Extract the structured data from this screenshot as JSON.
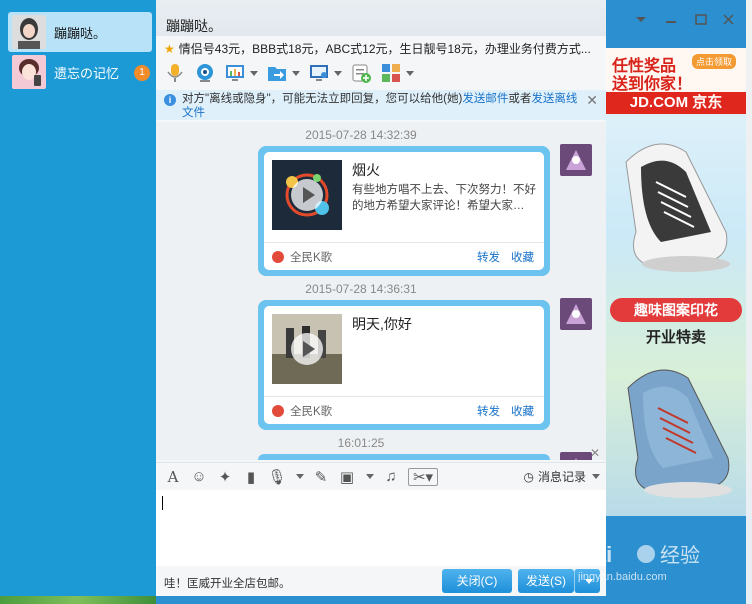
{
  "contacts": [
    {
      "name": "蹦蹦哒。",
      "active": true
    },
    {
      "name": "遗忘の记忆",
      "active": false,
      "badge": "1"
    }
  ],
  "window": {
    "title": "蹦蹦哒。",
    "signature": "情侣号43元，BBB式18元，ABC式12元，生日靓号18元，办理业务付费方式..."
  },
  "toolbar": {
    "icons": [
      "microphone-icon",
      "video-camera-icon",
      "screen-share-icon",
      "file-transfer-icon",
      "remote-desktop-icon",
      "add-app-icon",
      "apps-grid-icon"
    ]
  },
  "notice": {
    "text": "对方\"离线或隐身\"，可能无法立即回复，您可以给他(她)",
    "link1": "发送邮件",
    "middle": "或者",
    "link2": "发送离线文件"
  },
  "messages": [
    {
      "timestamp": "2015-07-28 14:32:39",
      "card_title": "烟火",
      "card_desc": "有些地方唱不上去、下次努力！不好的地方希望大家评论！希望大家…",
      "app": "全民K歌",
      "share": "转发",
      "favorite": "收藏"
    },
    {
      "timestamp": "2015-07-28 14:36:31",
      "card_title": "明天,你好",
      "card_desc": "",
      "app": "全民K歌",
      "share": "转发",
      "favorite": "收藏"
    },
    {
      "timestamp": "16:01:25"
    }
  ],
  "input_toolbar": {
    "message_record": "消息记录"
  },
  "bottom": {
    "tip": "哇！匡威开业全店包邮。",
    "close": "关闭(C)",
    "send": "发送(S)"
  },
  "ad": {
    "line1": "任性奖品",
    "chip": "点击领取",
    "line2": "送到你家！",
    "brand": "JD.COM 京东",
    "slogan1": "趣味图案印花",
    "slogan2": "开业特卖"
  },
  "watermark": {
    "text1": "Bai",
    "text2": "经验",
    "url": "jingyan.baidu.com"
  },
  "colors": {
    "sidebar": "#1b9ad6",
    "bubble": "#6cc3ef",
    "link": "#1b73c9",
    "send_button": "#1e8fd9",
    "badge": "#f28b2a"
  }
}
